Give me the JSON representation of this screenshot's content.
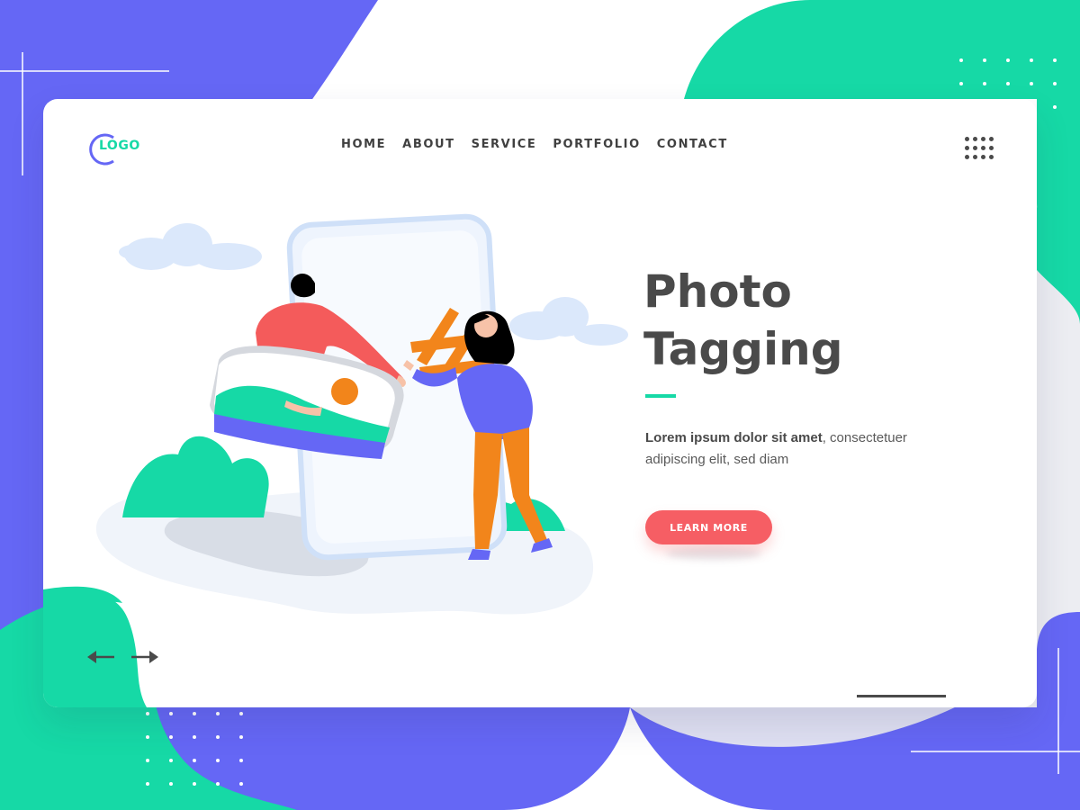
{
  "logo": {
    "text": "LOGO"
  },
  "nav": {
    "items": [
      "HOME",
      "ABOUT",
      "SERVICE",
      "PORTFOLIO",
      "CONTACT"
    ]
  },
  "hero": {
    "title_line1": "Photo",
    "title_line2": "Tagging",
    "description_bold": "Lorem ipsum dolor sit amet",
    "description_rest": ", consectetuer adipiscing elit, sed diam",
    "cta_label": "LEARN MORE"
  },
  "icons": {
    "menu": "grid-menu-icon",
    "prev": "arrow-left-icon",
    "next": "arrow-right-icon"
  },
  "colors": {
    "blue": "#6567f5",
    "teal": "#16d9a6",
    "coral": "#f65e64",
    "orange": "#f2851b",
    "text_dark": "#4a4a4a"
  }
}
